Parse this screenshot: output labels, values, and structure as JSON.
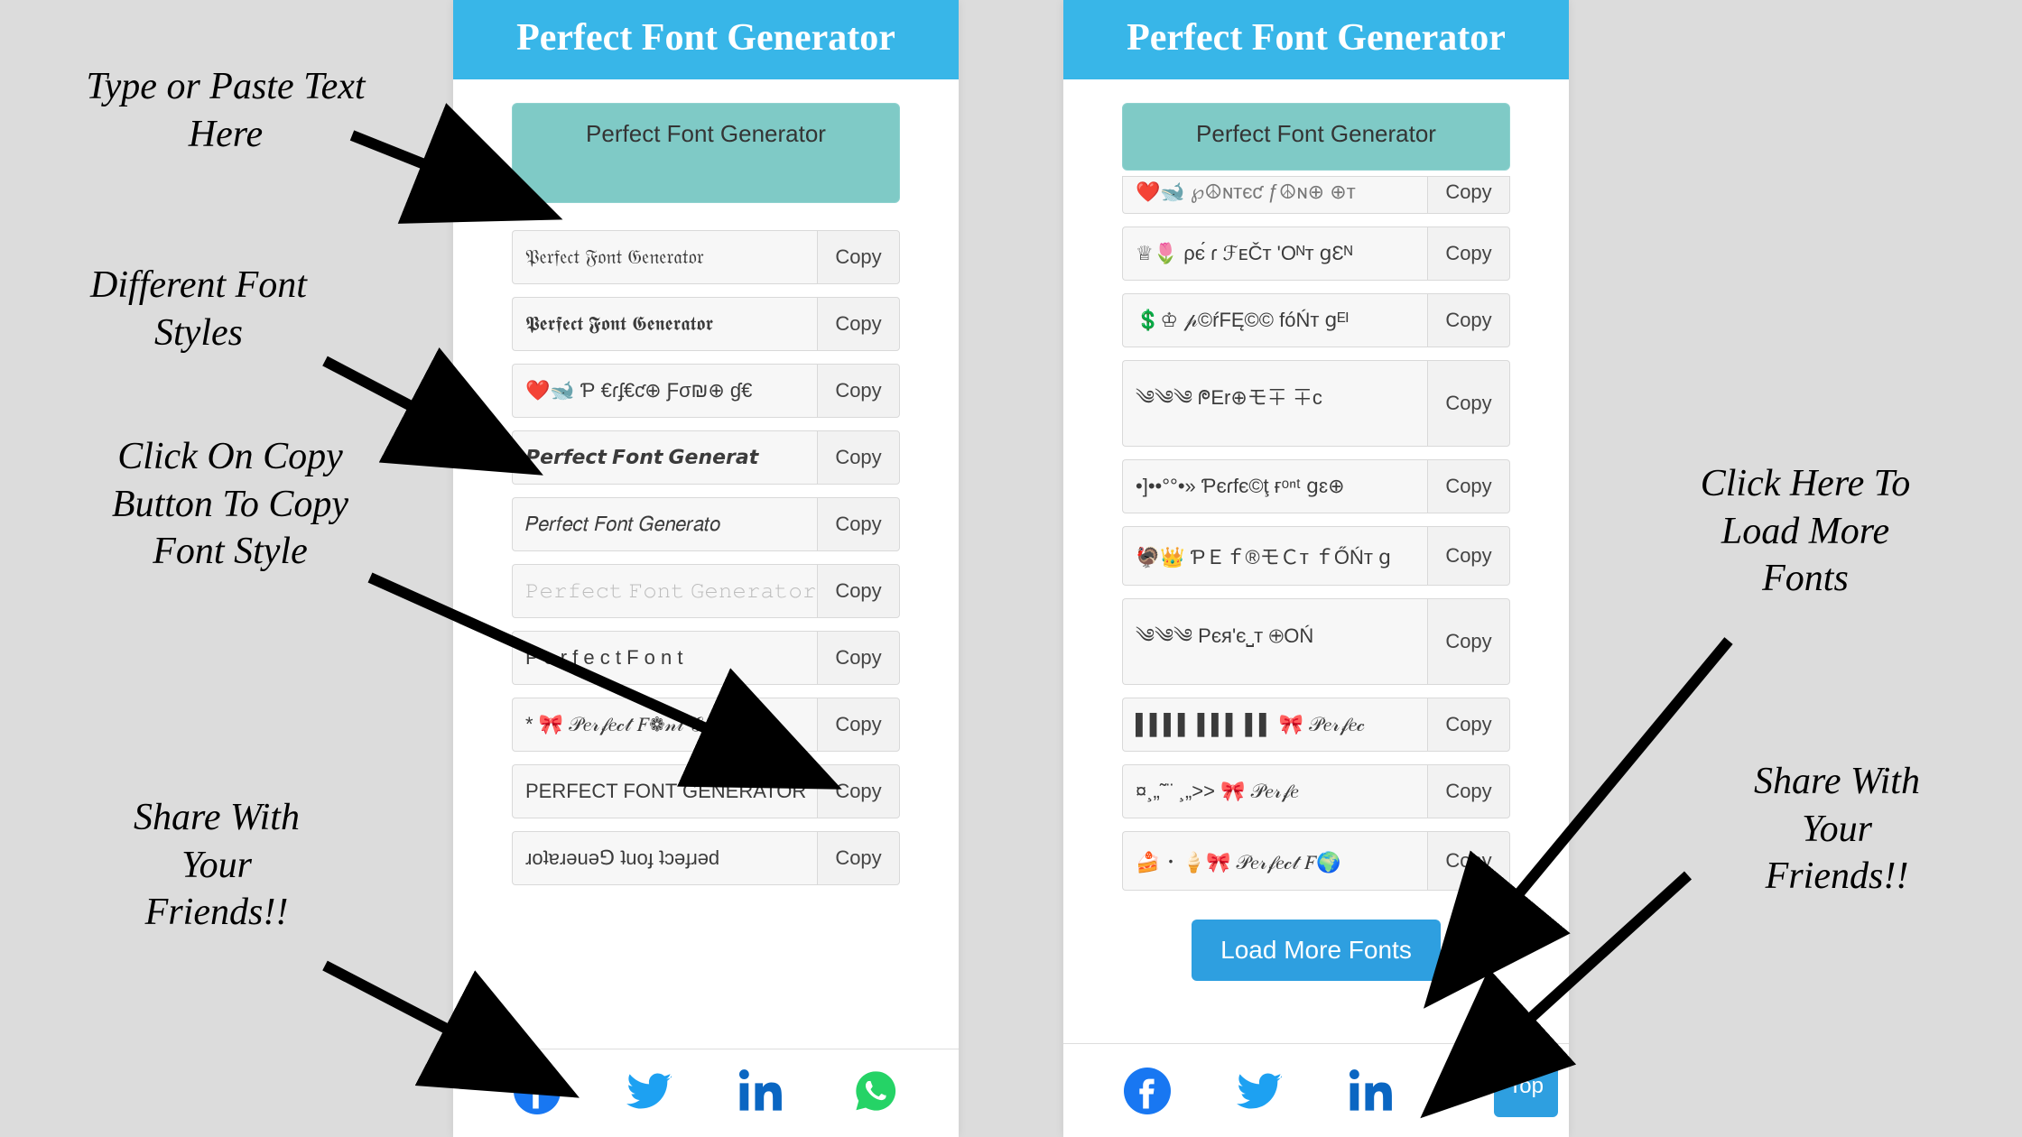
{
  "header_title": "Perfect Font Generator",
  "input_value": "Perfect Font Generator",
  "copy_label": "Copy",
  "load_more_label": "Load More Fonts",
  "top_label": "Top",
  "left_rows": [
    "𝔓𝔢𝔯𝔣𝔢𝔠𝔱 𝔉𝔬𝔫𝔱 𝔊𝔢𝔫𝔢𝔯𝔞𝔱𝔬𝔯",
    "𝕻𝖊𝖗𝖋𝖊𝖈𝖙 𝕱𝖔𝖓𝖙 𝕲𝖊𝖓𝖊𝖗𝖆𝖙𝖔𝖗",
    "❤️🐋 Ƥ €ɾʄ€ƈ⊕ Ƒσ₪⊕ ɠ€",
    "𝙋𝙚𝙧𝙛𝙚𝙘𝙩 𝙁𝙤𝙣𝙩 𝙂𝙚𝙣𝙚𝙧𝙖𝙩",
    "𝑃𝑒𝑟𝑓𝑒𝑐𝑡 𝐹𝑜𝑛𝑡 𝐺𝑒𝑛𝑒𝑟𝑎𝑡𝑜",
    "𝙿𝚎𝚛𝚏𝚎𝚌𝚝 𝙵𝚘𝚗𝚝 𝙶𝚎𝚗𝚎𝚛𝚊𝚝𝚘𝚛",
    "P e r f e c t   F o n t",
    "*  🎀  𝒫𝑒𝓇𝒻𝑒𝒸𝓉 𝐹❁𝓃𝓉 𝒢𝑒𝓃",
    "PERFECT FONT GENERATOR",
    "ɹoʇɐɹǝuǝ⅁ ʇuoɟ ʇɔǝɟɹǝd"
  ],
  "right_partial_row": "❤️🐋  ℘☮ɴтєƈ ƒ☮ɴ⊕ ⊕т",
  "right_rows": [
    "♕🌷 ρє́ ɾ ℱᴇČт 'Oᴺт ցƐᴺ",
    "💲♔  𝓅©ŕFĘ©© fóŃт ցᴱᴵ",
    "༄༄༄   ᖘEr⊕モ∓ ∓c",
    "•]••°°•» Ƥєɾfє©ţ ғᵒⁿᵗ ցɛ⊕",
    "🦃👑  ƤＥｆ®モＣт ｆŐŃт ց",
    "༄༄༄  Рєя'є⎵т ⊕OŃ",
    "▌▌▌▌ ▌▌▌ ▌▌  🎀  𝒫𝑒𝓇𝒻𝑒𝒸",
    "¤¸„˜¨ ¸„>>  🎀  𝒫𝑒𝓇𝒻𝑒",
    "🍰 ･ 🍦🎀  𝒫𝑒𝓇𝒻𝑒𝒸𝓉 𝐹🌍"
  ],
  "annotations": {
    "type_here": "Type or Paste Text\nHere",
    "diff_styles": "Different Font\nStyles",
    "click_copy": "Click On Copy\nButton To Copy\nFont Style",
    "share_left": "Share With\nYour\nFriends!!",
    "load_more": "Click Here To\nLoad More\nFonts",
    "share_right": "Share With\nYour\nFriends!!"
  }
}
